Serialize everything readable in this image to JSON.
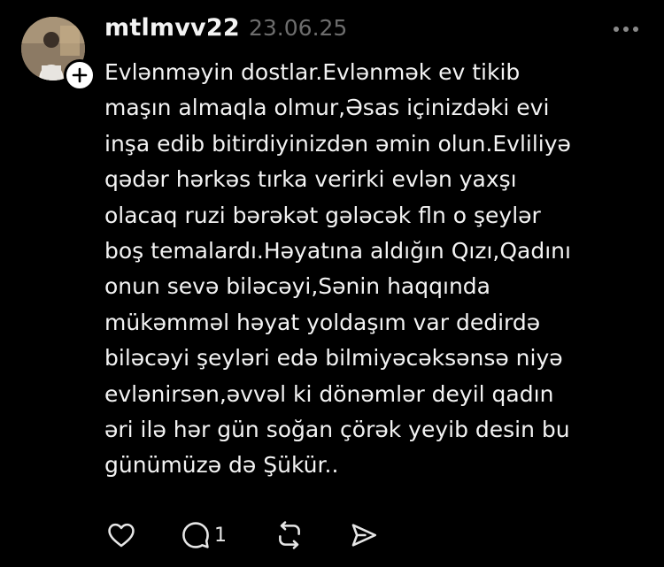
{
  "post": {
    "username": "mtlmvv22",
    "date": "23.06.25",
    "lines": [
      "Evlənməyin dostlar.Evlənmək ev tikib",
      "maşın almaqla olmur,Əsas içinizdəki evi",
      "inşa edib bitirdiyinizdən əmin olun.Evliliyə",
      "qədər hərkəs tırka verirki evlən yaxşı",
      "olacaq ruzi bərəkət gələcək fln o şeylər",
      "boş temalardı.Həyatına aldığın Qızı,Qadını",
      "onun sevə biləcəyi,Sənin haqqında",
      "mükəmməl həyat yoldaşım var dedirdə",
      "biləcəyi şeyləri edə bilmiyəcəksənsə niyə",
      "evlənirsən,əvvəl ki dönəmlər deyil qadın",
      "əri ilə hər gün soğan çörək yeyib desin bu",
      "günümüzə də Şükür.."
    ],
    "reply_count": "1"
  },
  "icons": {
    "avatar": "avatar-photo",
    "follow": "plus-icon",
    "more": "more-dots-icon",
    "like": "heart-icon",
    "reply": "comment-icon",
    "repost": "repost-icon",
    "share": "send-icon"
  },
  "colors": {
    "background": "#000000",
    "text": "#f3f3f3",
    "muted": "#6d6d6d"
  }
}
